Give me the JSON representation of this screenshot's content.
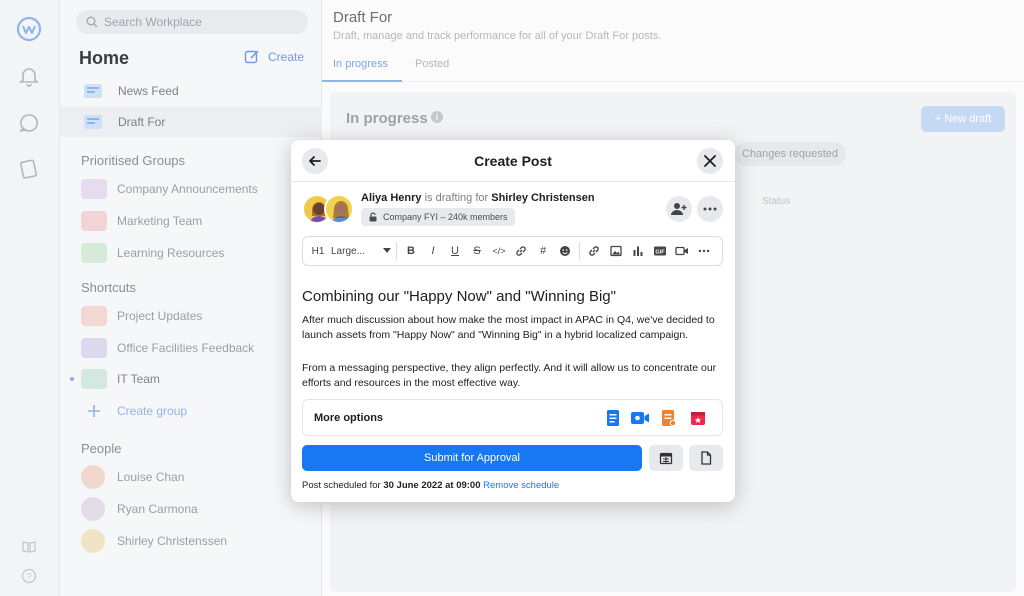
{
  "sidebar": {
    "search_placeholder": "Search Workplace",
    "home_title": "Home",
    "create_label": "Create",
    "nav": [
      {
        "label": "News Feed"
      },
      {
        "label": "Draft For"
      }
    ],
    "prioritised_title": "Prioritised Groups",
    "groups": [
      {
        "label": "Company Announcements"
      },
      {
        "label": "Marketing Team"
      },
      {
        "label": "Learning Resources"
      }
    ],
    "shortcuts_title": "Shortcuts",
    "shortcuts": [
      {
        "label": "Project Updates"
      },
      {
        "label": "Office Facilities Feedback"
      },
      {
        "label": "IT Team"
      },
      {
        "label": "Create group"
      }
    ],
    "people_title": "People",
    "people": [
      {
        "label": "Louise Chan"
      },
      {
        "label": "Ryan Carmona"
      },
      {
        "label": "Shirley Christenssen"
      }
    ]
  },
  "main": {
    "title": "Draft For",
    "subtitle": "Draft, manage and track performance for all of your Draft For posts.",
    "tabs": [
      {
        "label": "In progress"
      },
      {
        "label": "Posted"
      }
    ],
    "section_title": "In progress",
    "new_draft_label": "+ New draft",
    "filter_chip": "Changes requested",
    "status_col": "Status"
  },
  "modal": {
    "title": "Create Post",
    "author": "Aliya Henry",
    "drafting_text": "is drafting for",
    "target": "Shirley Christensen",
    "audience": "Company FYI – 240k members",
    "toolbar": {
      "heading_level": "H1",
      "text_size": "Large...",
      "bold": "B",
      "italic": "I",
      "underline": "U",
      "strike": "S",
      "code": "</>",
      "hash": "#"
    },
    "post_heading": "Combining our \"Happy Now\" and \"Winning Big\"",
    "para1": "After much discussion about how make the most impact in APAC in Q4, we've decided to launch assets from \"Happy Now\" and \"Winning Big\" in a hybrid localized campaign.",
    "para2": "From a messaging perspective, they align perfectly. And it will allow us to concentrate our efforts and resources in the most effective way.",
    "more_options_label": "More options",
    "submit_label": "Submit for Approval",
    "schedule_prefix": "Post scheduled for",
    "schedule_datetime": "30 June 2022 at 09:00",
    "remove_schedule": "Remove schedule"
  },
  "colors": {
    "accent": "#1877f2",
    "sidebar_bg": "#f6f7f9"
  }
}
